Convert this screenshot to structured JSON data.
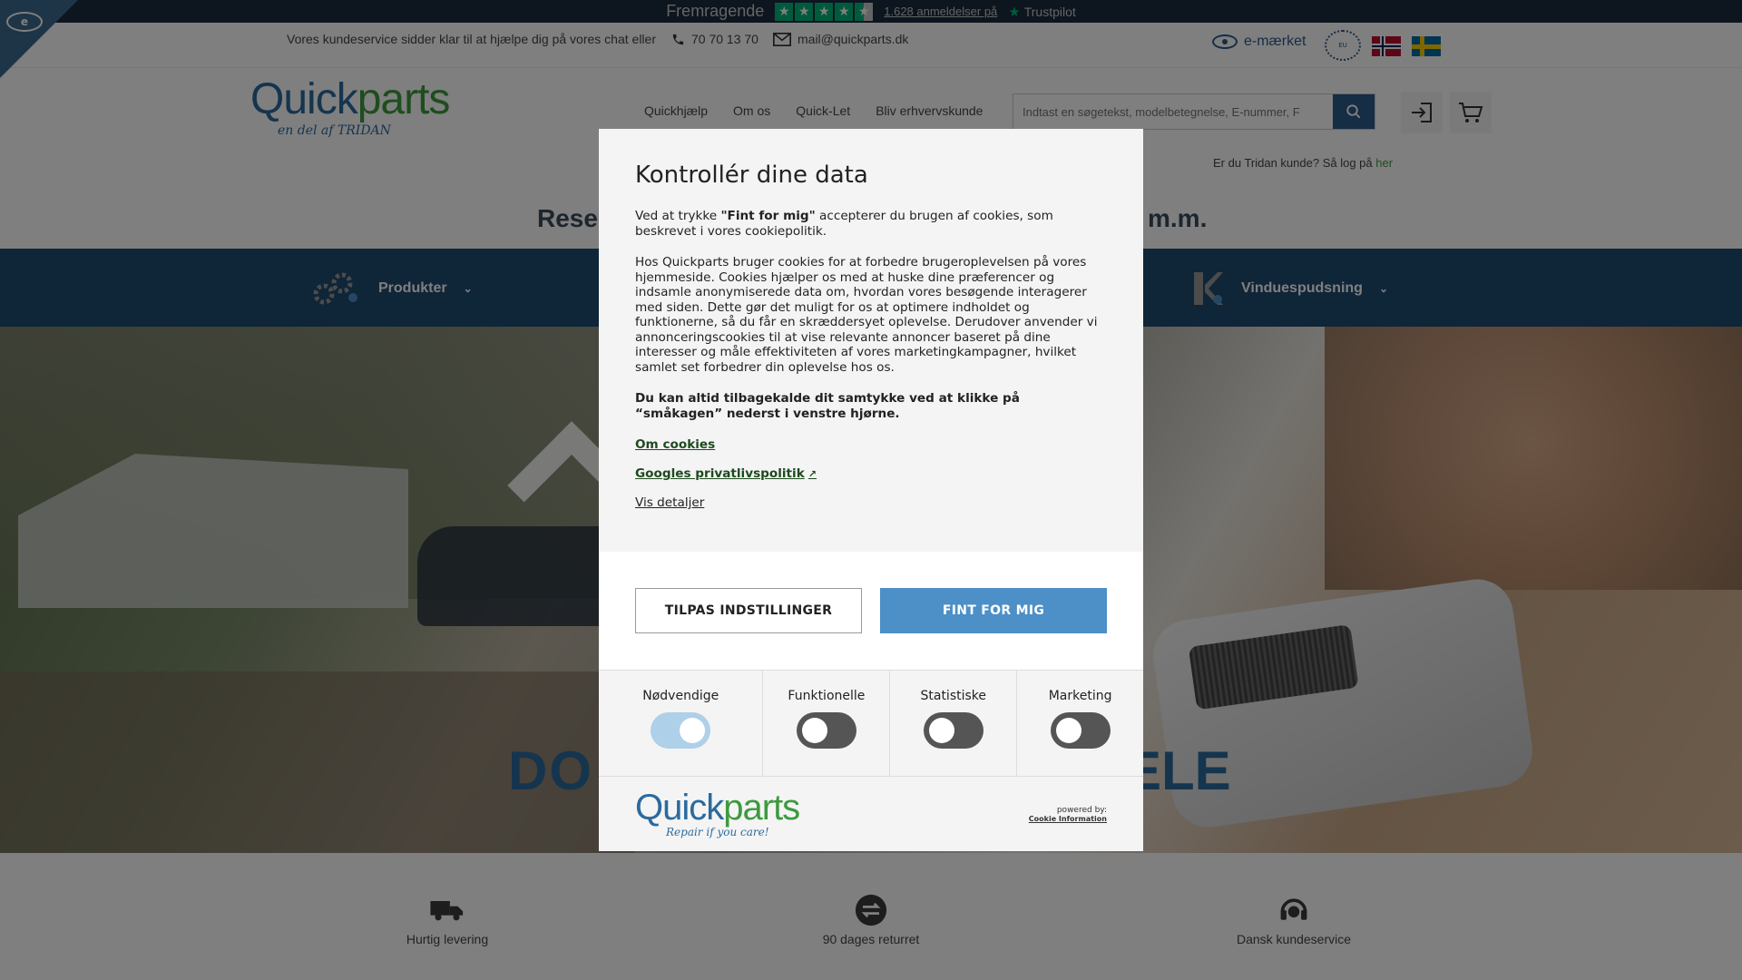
{
  "trustpilot": {
    "rating_text": "Fremragende",
    "reviews_link": "1.628 anmeldelser på",
    "brand": "Trustpilot"
  },
  "contact": {
    "service_text": "Vores kundeservice sidder klar til at hjælpe dig på vores chat eller",
    "phone": "70 70 13 70",
    "email": "mail@quickparts.dk",
    "emaerket": "e-mærket"
  },
  "header": {
    "logo_text_blue": "Quick",
    "logo_text_green": "parts",
    "logo_sub": "en del af TRIDAN",
    "nav": [
      "Quickhjælp",
      "Om os",
      "Quick-Let",
      "Bliv erhvervskunde"
    ],
    "search_placeholder": "Indtast en søgetekst, modelbetegnelse, E-nummer, F",
    "tridan_login_text": "Er du Tridan kunde? Så log på",
    "tridan_login_link": "her",
    "headline_left": "Reser",
    "headline_right": "m.m."
  },
  "categories": [
    {
      "label": "Produkter"
    },
    {
      "label": "Vinduespudsning"
    }
  ],
  "hero": {
    "text_left": "DO",
    "text_right": "ELE"
  },
  "features": [
    {
      "label": "Hurtig levering"
    },
    {
      "label": "90 dages returret"
    },
    {
      "label": "Dansk kundeservice"
    }
  ],
  "cookie_modal": {
    "title": "Kontrollér dine data",
    "intro_prefix": "Ved at trykke ",
    "intro_bold": "\"Fint for mig\"",
    "intro_suffix": " accepterer du brugen af cookies, som beskrevet i vores cookiepolitik.",
    "body": "Hos Quickparts bruger cookies for at forbedre brugeroplevelsen på vores hjemmeside. Cookies hjælper os med at huske dine præferencer og indsamle anonymiserede data om, hvordan vores besøgende interagerer med siden. Dette gør det muligt for os at optimere indholdet og funktionerne, så du får en skræddersyet oplevelse. Derudover anvender vi annonceringscookies til at vise relevante annoncer baseret på dine interesser og måle effektiviteten af vores marketingkampagner, hvilket samlet set forbedrer din oplevelse hos os.",
    "revoke": "Du kan altid tilbagekalde dit samtykke ved at klikke på “småkagen” nederst i venstre hjørne.",
    "link_about": "Om cookies",
    "link_google": "Googles privatlivspolitik",
    "link_details": "Vis detaljer",
    "btn_customize": "TILPAS INDSTILLINGER",
    "btn_accept": "FINT FOR MIG",
    "toggles": [
      {
        "label": "Nødvendige",
        "on": true
      },
      {
        "label": "Funktionelle",
        "on": false
      },
      {
        "label": "Statistiske",
        "on": false
      },
      {
        "label": "Marketing",
        "on": false
      }
    ],
    "footer_logo_blue": "Quick",
    "footer_logo_green": "parts",
    "footer_tagline": "Repair if you care!",
    "powered_by": "powered by:",
    "powered_brand": "Cookie Information"
  }
}
